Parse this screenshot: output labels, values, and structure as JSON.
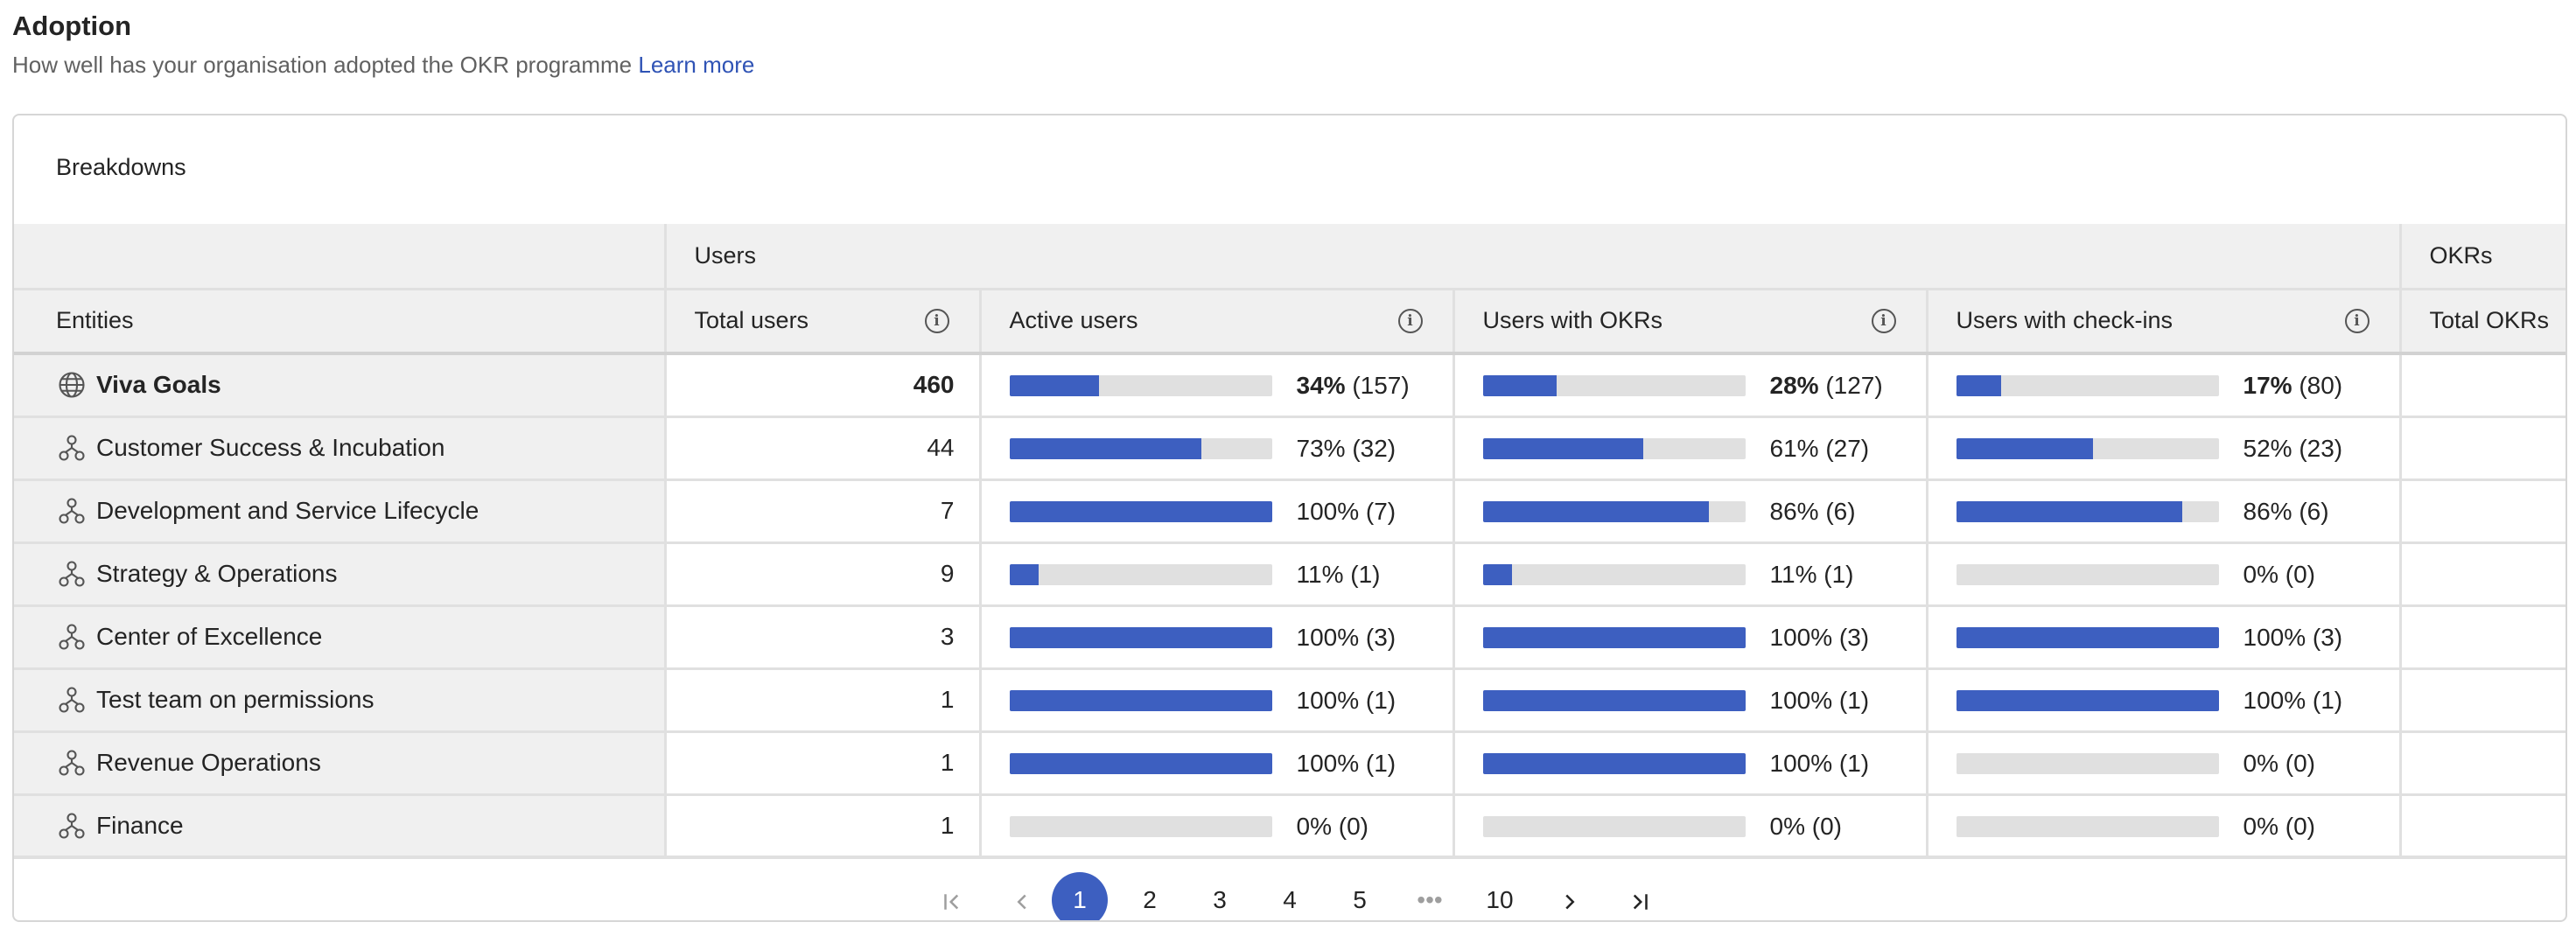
{
  "header": {
    "title": "Adoption",
    "subtitle": "How well has your organisation adopted the OKR programme",
    "learn_more": "Learn more"
  },
  "card": {
    "title": "Breakdowns",
    "group_users": "Users",
    "group_okrs": "OKRs",
    "columns": {
      "entities": "Entities",
      "total_users": "Total users",
      "active_users": "Active users",
      "users_with_okrs": "Users with OKRs",
      "users_with_checkins": "Users with check-ins",
      "total_okrs": "Total OKRs"
    }
  },
  "rows": [
    {
      "name": "Viva Goals",
      "icon": "globe-icon",
      "total": "460",
      "active": {
        "pct": 34,
        "label": "34%",
        "count": "(157)"
      },
      "okrs": {
        "pct": 28,
        "label": "28%",
        "count": "(127)"
      },
      "checkins": {
        "pct": 17,
        "label": "17%",
        "count": "(80)"
      }
    },
    {
      "name": "Customer Success & Incubation",
      "icon": "org-icon",
      "total": "44",
      "active": {
        "pct": 73,
        "label": "73%",
        "count": "(32)"
      },
      "okrs": {
        "pct": 61,
        "label": "61%",
        "count": "(27)"
      },
      "checkins": {
        "pct": 52,
        "label": "52%",
        "count": "(23)"
      }
    },
    {
      "name": "Development and Service Lifecycle",
      "icon": "org-icon",
      "total": "7",
      "active": {
        "pct": 100,
        "label": "100%",
        "count": "(7)"
      },
      "okrs": {
        "pct": 86,
        "label": "86%",
        "count": "(6)"
      },
      "checkins": {
        "pct": 86,
        "label": "86%",
        "count": "(6)"
      }
    },
    {
      "name": "Strategy & Operations",
      "icon": "org-icon",
      "total": "9",
      "active": {
        "pct": 11,
        "label": "11%",
        "count": "(1)"
      },
      "okrs": {
        "pct": 11,
        "label": "11%",
        "count": "(1)"
      },
      "checkins": {
        "pct": 0,
        "label": "0%",
        "count": "(0)"
      }
    },
    {
      "name": "Center of Excellence",
      "icon": "org-icon",
      "total": "3",
      "active": {
        "pct": 100,
        "label": "100%",
        "count": "(3)"
      },
      "okrs": {
        "pct": 100,
        "label": "100%",
        "count": "(3)"
      },
      "checkins": {
        "pct": 100,
        "label": "100%",
        "count": "(3)"
      }
    },
    {
      "name": "Test team on permissions",
      "icon": "org-icon",
      "total": "1",
      "active": {
        "pct": 100,
        "label": "100%",
        "count": "(1)"
      },
      "okrs": {
        "pct": 100,
        "label": "100%",
        "count": "(1)"
      },
      "checkins": {
        "pct": 100,
        "label": "100%",
        "count": "(1)"
      }
    },
    {
      "name": "Revenue Operations",
      "icon": "org-icon",
      "total": "1",
      "active": {
        "pct": 100,
        "label": "100%",
        "count": "(1)"
      },
      "okrs": {
        "pct": 100,
        "label": "100%",
        "count": "(1)"
      },
      "checkins": {
        "pct": 0,
        "label": "0%",
        "count": "(0)"
      }
    },
    {
      "name": "Finance",
      "icon": "org-icon",
      "total": "1",
      "active": {
        "pct": 0,
        "label": "0%",
        "count": "(0)"
      },
      "okrs": {
        "pct": 0,
        "label": "0%",
        "count": "(0)"
      },
      "checkins": {
        "pct": 0,
        "label": "0%",
        "count": "(0)"
      }
    }
  ],
  "pager": {
    "pages": [
      "1",
      "2",
      "3",
      "4",
      "5"
    ],
    "ellipsis": "•••",
    "last_page": "10",
    "current": "1"
  },
  "colors": {
    "accent": "#3d5fc0",
    "bar_track": "#e0e0e0",
    "header_bg": "#f0f0f0",
    "link": "#2f53b5"
  }
}
